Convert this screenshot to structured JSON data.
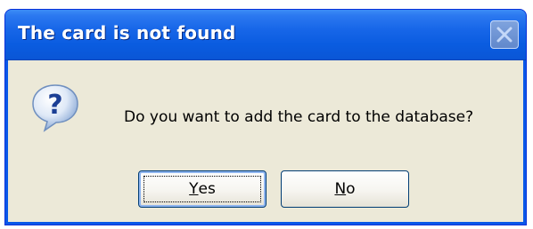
{
  "dialog": {
    "title": "The card is not found",
    "message": "Do you want to add the card to the database?",
    "icon": "question-icon",
    "yes_button": {
      "mnemonic": "Y",
      "rest": "es"
    },
    "no_button": {
      "mnemonic": "N",
      "rest": "o"
    }
  },
  "colors": {
    "titlebar": "#0a5ce0",
    "client": "#ece9d8",
    "button_border": "#003c74"
  }
}
